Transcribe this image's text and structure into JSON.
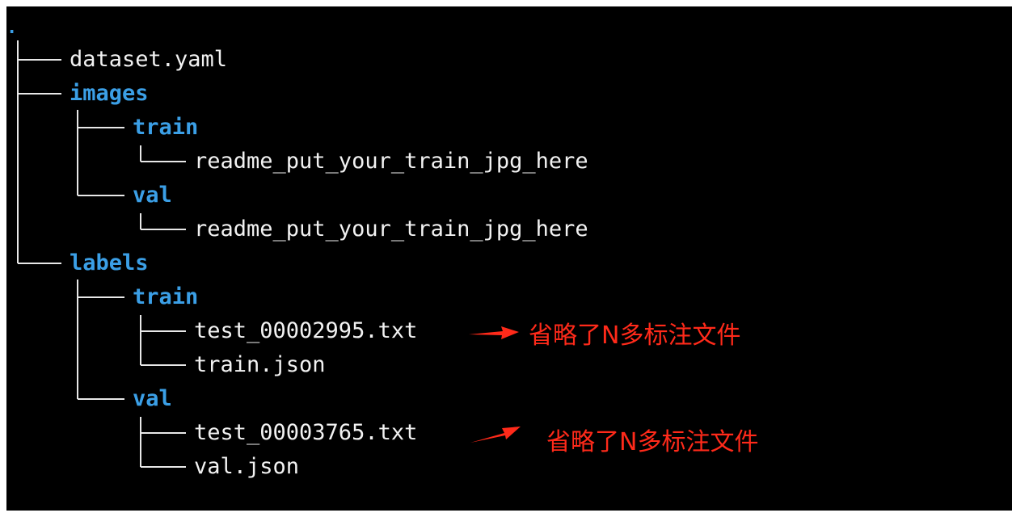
{
  "tree": {
    "root": ".",
    "items": [
      {
        "name": "dataset.yaml",
        "kind": "file"
      },
      {
        "name": "images",
        "kind": "dir"
      },
      {
        "name": "train",
        "kind": "dir"
      },
      {
        "name": "readme_put_your_train_jpg_here",
        "kind": "file"
      },
      {
        "name": "val",
        "kind": "dir"
      },
      {
        "name": "readme_put_your_train_jpg_here",
        "kind": "file"
      },
      {
        "name": "labels",
        "kind": "dir"
      },
      {
        "name": "train",
        "kind": "dir"
      },
      {
        "name": "test_00002995.txt",
        "kind": "file"
      },
      {
        "name": "train.json",
        "kind": "file"
      },
      {
        "name": "val",
        "kind": "dir"
      },
      {
        "name": "test_00003765.txt",
        "kind": "file"
      },
      {
        "name": "val.json",
        "kind": "file"
      }
    ]
  },
  "annotations": {
    "note_1": "省略了N多标注文件",
    "note_2": "省略了N多标注文件"
  },
  "colors": {
    "background": "#000000",
    "directory": "#3b9fe6",
    "file": "#f2f2f2",
    "annotation": "#ff2a1a"
  }
}
